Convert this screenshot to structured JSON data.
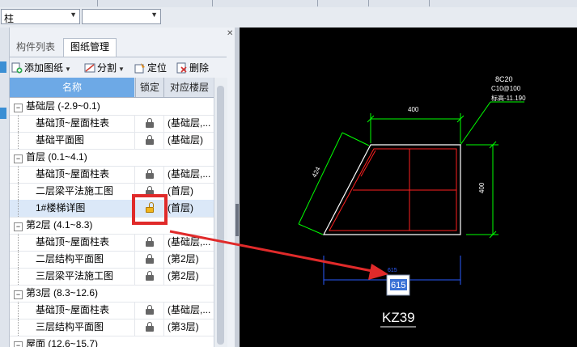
{
  "toolbar": {
    "combo1_value": "柱",
    "combo2_value": ""
  },
  "panel": {
    "tabs": [
      "构件列表",
      "图纸管理"
    ],
    "active_tab": "图纸管理",
    "tools": {
      "add": "添加图纸",
      "split": "分割",
      "locate": "定位",
      "delete": "删除"
    },
    "columns": {
      "name": "名称",
      "lock": "锁定",
      "floor": "对应楼层"
    },
    "rows": [
      {
        "type": "group",
        "name": "基础层 (-2.9~0.1)"
      },
      {
        "type": "item",
        "name": "基础顶~屋面柱表",
        "floor": "(基础层,..."
      },
      {
        "type": "item",
        "name": "基础平面图",
        "floor": "(基础层)"
      },
      {
        "type": "group",
        "name": "首层 (0.1~4.1)"
      },
      {
        "type": "item",
        "name": "基础顶~屋面柱表",
        "floor": "(基础层,..."
      },
      {
        "type": "item",
        "name": "二层梁平法施工图",
        "floor": "(首层)"
      },
      {
        "type": "item",
        "name": "1#楼梯详图",
        "floor": "(首层)",
        "unlocked": true,
        "selected": true
      },
      {
        "type": "group",
        "name": "第2层 (4.1~8.3)"
      },
      {
        "type": "item",
        "name": "基础顶~屋面柱表",
        "floor": "(基础层,..."
      },
      {
        "type": "item",
        "name": "二层结构平面图",
        "floor": "(第2层)"
      },
      {
        "type": "item",
        "name": "三层梁平法施工图",
        "floor": "(第2层)"
      },
      {
        "type": "group",
        "name": "第3层 (8.3~12.6)"
      },
      {
        "type": "item",
        "name": "基础顶~屋面柱表",
        "floor": "(基础层,..."
      },
      {
        "type": "item",
        "name": "三层结构平面图",
        "floor": "(第3层)"
      },
      {
        "type": "group",
        "name": "屋面 (12.6~15.7)"
      }
    ]
  },
  "cad": {
    "rebar_line1": "8C20",
    "rebar_line2": "C10@100",
    "rebar_line3": "标高-11.190",
    "dim_top": "400",
    "dim_right": "400",
    "dim_slant": "424",
    "dim_bottom": "615",
    "edit_value": "615",
    "column_label": "KZ39",
    "colors": {
      "green": "#00ff00",
      "red": "#ff2020",
      "blue": "#2a5bff",
      "white": "#ffffff"
    }
  }
}
